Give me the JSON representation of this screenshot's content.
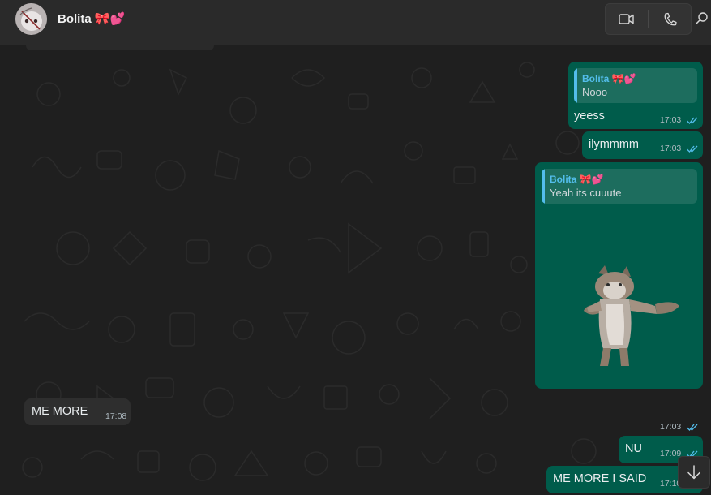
{
  "header": {
    "name": "Bolita 🎀💕",
    "avatar_icon": "profile-photo",
    "video_icon": "video-camera-icon",
    "voice_icon": "phone-icon",
    "search_icon": "search-icon"
  },
  "colors": {
    "outgoing_bubble": "#005c4b",
    "incoming_bubble": "#2e2e2e",
    "quote_accent": "#53bdeb",
    "read_ticks": "#53bdeb"
  },
  "messages": [
    {
      "direction": "out",
      "quote_author": "Bolita 🎀💕",
      "quote_text": "Nooo",
      "text": "yeess",
      "time": "17:03",
      "status": "read"
    },
    {
      "direction": "out",
      "text": "ilymmmm",
      "time": "17:03",
      "status": "read"
    },
    {
      "direction": "out",
      "quote_author": "Bolita 🎀💕",
      "quote_text": "Yeah its cuuute",
      "sticker": "dancing-cat-sticker",
      "time": "17:03",
      "status": "read"
    },
    {
      "direction": "in",
      "text": "ME MORE",
      "time": "17:08"
    },
    {
      "direction": "out",
      "text": "NU",
      "time": "17:09",
      "status": "read"
    },
    {
      "direction": "out",
      "text": "ME MORE I SAID",
      "time": "17:10",
      "status": "read"
    }
  ],
  "scroll_down_icon": "arrow-down-icon"
}
